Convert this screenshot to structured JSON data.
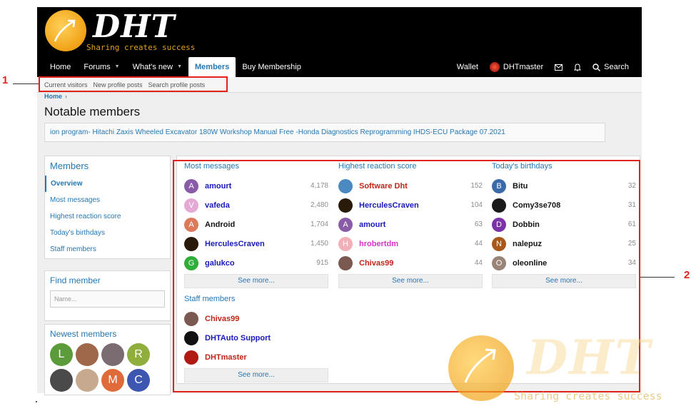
{
  "header": {
    "logo_text": "DHT",
    "tagline": "Sharing creates success"
  },
  "nav": {
    "tabs": [
      {
        "label": "Home",
        "has_caret": false
      },
      {
        "label": "Forums",
        "has_caret": true
      },
      {
        "label": "What's new",
        "has_caret": true
      },
      {
        "label": "Members",
        "has_caret": false,
        "active": true
      },
      {
        "label": "Buy Membership",
        "has_caret": false
      }
    ],
    "wallet": "Wallet",
    "user": "DHTmaster",
    "search": "Search"
  },
  "subnav": [
    "Current visitors",
    "New profile posts",
    "Search profile posts"
  ],
  "breadcrumb": {
    "home": "Home"
  },
  "page": {
    "title": "Notable members",
    "notice": "ion program- Hitachi Zaxis Wheeled Excavator 180W Workshop Manual Free -Honda Diagnostics Reprogramming IHDS-ECU Package 07.2021"
  },
  "sidebar": {
    "members_title": "Members",
    "items": [
      "Overview",
      "Most messages",
      "Highest reaction score",
      "Today's birthdays",
      "Staff members"
    ],
    "find_title": "Find member",
    "find_placeholder": "Name...",
    "newest_title": "Newest members",
    "newest": [
      {
        "initial": "L",
        "color": "#5b9b3a"
      },
      {
        "initial": "",
        "color": "#a0684a"
      },
      {
        "initial": "",
        "color": "#7a6c70"
      },
      {
        "initial": "R",
        "color": "#8fae3d"
      },
      {
        "initial": "",
        "color": "#4a4a4a"
      },
      {
        "initial": "",
        "color": "#c7a98f"
      },
      {
        "initial": "M",
        "color": "#e06a3a"
      },
      {
        "initial": "C",
        "color": "#3d56b0"
      }
    ]
  },
  "lists": {
    "most_messages": {
      "title": "Most messages",
      "members": [
        {
          "name": "amourt",
          "value": "4,178",
          "initial": "A",
          "color": "#8a5ca8",
          "name_color": "#1a1ab8"
        },
        {
          "name": "vafeda",
          "value": "2,480",
          "initial": "V",
          "color": "#e5a9d6",
          "name_color": "#1a1ab8"
        },
        {
          "name": "Android",
          "value": "1,704",
          "initial": "A",
          "color": "#dd7a5c",
          "name_color": "#141414"
        },
        {
          "name": "HerculesCraven",
          "value": "1,450",
          "initial": "",
          "color": "#2a1a0a",
          "name_color": "#1a1ab8"
        },
        {
          "name": "galukco",
          "value": "915",
          "initial": "G",
          "color": "#2fae3a",
          "name_color": "#1a1ab8"
        }
      ],
      "see_more": "See more..."
    },
    "highest_reaction": {
      "title": "Highest reaction score",
      "members": [
        {
          "name": "Software Dht",
          "value": "152",
          "initial": "",
          "color": "#4a8ac0",
          "name_color": "#c0251a"
        },
        {
          "name": "HerculesCraven",
          "value": "104",
          "initial": "",
          "color": "#2a1a0a",
          "name_color": "#1a1ab8"
        },
        {
          "name": "amourt",
          "value": "63",
          "initial": "A",
          "color": "#8a5ca8",
          "name_color": "#1a1ab8"
        },
        {
          "name": "hrobertdm",
          "value": "44",
          "initial": "H",
          "color": "#f2b0b8",
          "name_color": "#d633c9"
        },
        {
          "name": "Chivas99",
          "value": "44",
          "initial": "",
          "color": "#7a5a50",
          "name_color": "#c0251a"
        }
      ],
      "see_more": "See more..."
    },
    "birthdays": {
      "title": "Today's birthdays",
      "members": [
        {
          "name": "Bitu",
          "value": "32",
          "initial": "B",
          "color": "#3a6aa8",
          "name_color": "#141414"
        },
        {
          "name": "Comy3se708",
          "value": "31",
          "initial": "",
          "color": "#1a1a1a",
          "name_color": "#141414"
        },
        {
          "name": "Dobbin",
          "value": "61",
          "initial": "D",
          "color": "#7a34a8",
          "name_color": "#141414"
        },
        {
          "name": "nalepuz",
          "value": "25",
          "initial": "N",
          "color": "#a8581a",
          "name_color": "#141414"
        },
        {
          "name": "oleonline",
          "value": "34",
          "initial": "O",
          "color": "#9a8478",
          "name_color": "#141414"
        }
      ],
      "see_more": "See more..."
    },
    "staff": {
      "title": "Staff members",
      "members": [
        {
          "name": "Chivas99",
          "initial": "",
          "color": "#7a5a50",
          "name_color": "#c0251a"
        },
        {
          "name": "DHTAuto Support",
          "initial": "",
          "color": "#111111",
          "name_color": "#1a1ab8"
        },
        {
          "name": "DHTmaster",
          "initial": "",
          "color": "#b01a12",
          "name_color": "#c0251a"
        }
      ],
      "see_more": "See more..."
    }
  },
  "annotations": {
    "label_1": "1",
    "label_2": "2"
  },
  "watermark": {
    "text": "DHT",
    "tagline": "Sharing creates success"
  }
}
